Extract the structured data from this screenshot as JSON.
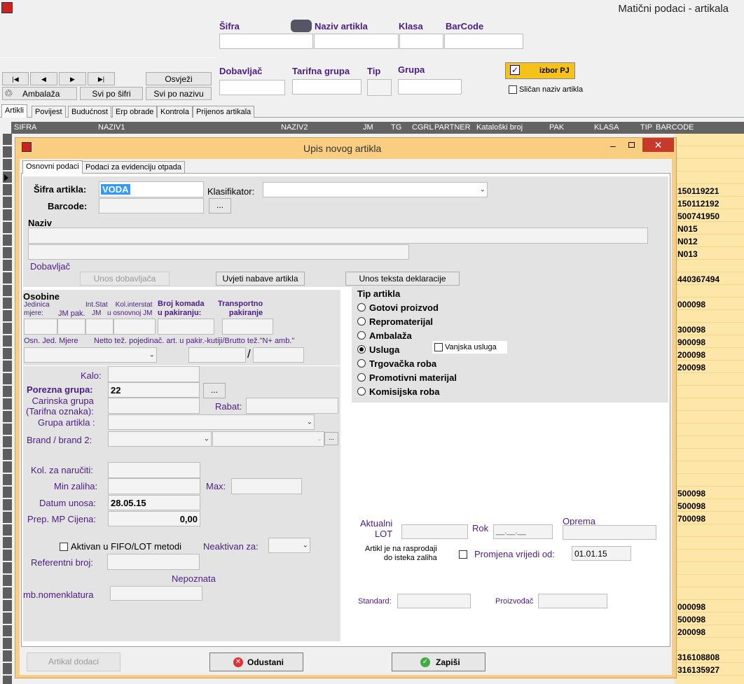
{
  "app": {
    "title": "Matični podaci - artikala"
  },
  "search": {
    "sifra": "Šifra",
    "naziv": "Naziv artikla",
    "klasa": "Klasa",
    "barcode": "BarCode",
    "dobavljac": "Dobavljač",
    "tarifna": "Tarifna grupa",
    "tip": "Tip",
    "grupa": "Grupa",
    "izbor": "izbor PJ",
    "slican": "Sličan naziv artikla"
  },
  "nav": {
    "first": "|◀",
    "prev": "◀",
    "next": "▶",
    "last": "▶|",
    "osvjezi": "Osvježi",
    "ambalaza": "Ambalaža",
    "svi_sifri": "Svi po šifri",
    "svi_nazivu": "Svi po nazivu"
  },
  "main_tabs": [
    "Artikli",
    "Povijest",
    "Budućnost",
    "Erp obrade",
    "Kontrola",
    "Prijenos artikala"
  ],
  "grid": {
    "headers": [
      "SIFRA",
      "NAZIV1",
      "NAZIV2",
      "JM",
      "TG",
      "CGRL",
      "PARTNER",
      "Kataloški broj",
      "PAK",
      "KLASA",
      "TIP",
      "BARCODE"
    ],
    "barcodes": [
      "150119221",
      "150112192",
      "500741950",
      "N015",
      "N012",
      "N013",
      "440367494",
      "000098",
      "300098",
      "900098",
      "200098",
      "200098",
      "500098",
      "500098",
      "700098",
      "000098",
      "500098",
      "200098",
      "316108808",
      "316135927"
    ]
  },
  "dialog": {
    "title": "Upis novog artikla",
    "tabs": [
      "Osnovni podaci",
      "Podaci za evidenciju otpada"
    ],
    "sifra_label": "Šifra artikla:",
    "sifra_value": "VODA",
    "klasifikator": "Klasifikator:",
    "barcode": "Barcode:",
    "dots": "...",
    "naziv": "Naziv",
    "dobavljac": "Dobavljač",
    "unos_dob": "Unos dobavljača",
    "uvjeti": "Uvjeti nabave artikla",
    "unos_teksta": "Unos teksta deklaracije",
    "osobine": "Osobine",
    "jm": "Jedinica\nmjere:",
    "jm_pak": "JM pak.",
    "int_stat": "Int.Stat\nJM",
    "kol_inter": "Kol.interstat\nu osnovnoj JM",
    "broj_kom": "Broj komada\nu pakiranju:",
    "transp": "Transportno\npakiranje",
    "osn_jed": "Osn. Jed. Mjere",
    "netto": "Netto tež. pojedinač. art. u pakir.-kutiji/Brutto tež.\"N+ amb.\"",
    "slash": "/",
    "kalo": "Kalo:",
    "porezna": "Porezna grupa:",
    "porezna_val": "22",
    "carinska": "Carinska grupa\n(Tarifna oznaka):",
    "rabat": "Rabat:",
    "grupa_art": "Grupa artikla :",
    "brand": "Brand / brand 2:",
    "kol_nar": "Kol. za naručiti:",
    "min_zal": "Min zaliha:",
    "max": "Max:",
    "datum": "Datum unosa:",
    "datum_val": "28.05.15",
    "prep": "Prep. MP Cijena:",
    "prep_val": "0,00",
    "aktivan": "Aktivan u FIFO/LOT metodi",
    "neaktivan": "Neaktivan za:",
    "referentni": "Referentni broj:",
    "nepoznata": "Nepoznata",
    "komb": "mb.nomenklatura",
    "tip_artikla": "Tip artikla",
    "tipovi": [
      "Gotovi proizvod",
      "Repromaterijal",
      "Ambalaža",
      "Usluga",
      "Trgovačka roba",
      "Promotivni materijal",
      "Komisijska roba"
    ],
    "vanjska": "Vanjska usluga",
    "lot": "Aktualni\nLOT",
    "rok": "Rok",
    "rok_val": "__.__.__",
    "oprema": "Oprema",
    "rasprodaja": "Artikl je na rasprodaji\ndo isteka zaliha",
    "promjena": "Promjena vrijedi od:",
    "promjena_val": "01.01.15",
    "standard": "Standard:",
    "proizvodjac": "Proizvođač",
    "btn_dodaci": "Artikal dodaci",
    "btn_odustani": "Odustani",
    "btn_zapisi": "Zapiši"
  }
}
